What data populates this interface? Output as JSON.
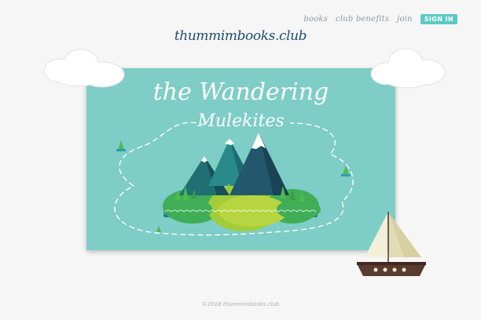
{
  "nav": {
    "books": "books",
    "club_benefits": "club benefits",
    "join": "join",
    "sign_in": "SIGN IN"
  },
  "logo": {
    "text": "thummimbooks.club"
  },
  "hero": {
    "title_line1": "the Wandering",
    "title_line2": "Mulekites",
    "background_color": "#7ecdc6"
  },
  "footer": {
    "text": "©2018 thummimbooks.club"
  },
  "colors": {
    "accent": "#5cc9c4",
    "logo": "#1f4d6b",
    "nav_text": "#8a9aa5"
  }
}
